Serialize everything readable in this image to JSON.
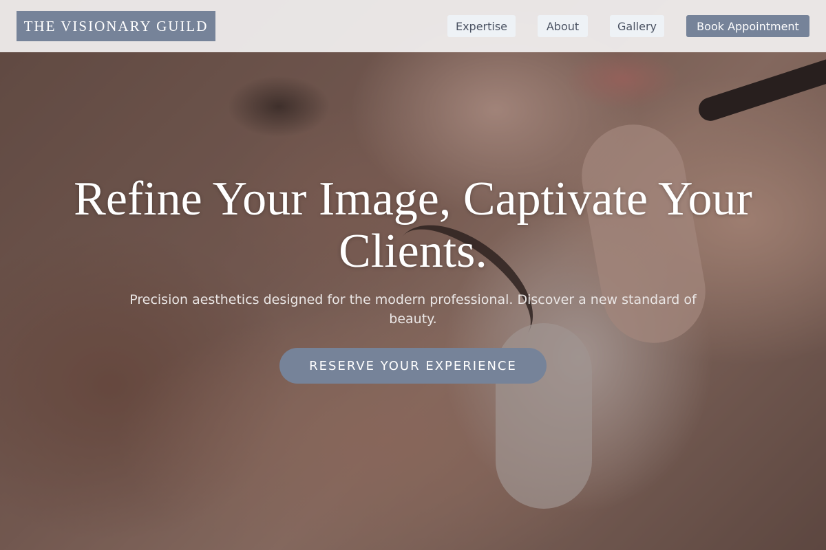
{
  "header": {
    "logo_text": "THE VISIONARY GUILD",
    "nav": {
      "expertise": "Expertise",
      "about": "About",
      "gallery": "Gallery",
      "book": "Book Appointment"
    }
  },
  "hero": {
    "title": "Refine Your Image, Captivate Your Clients.",
    "subtitle": "Precision aesthetics designed for the modern professional. Discover a new standard of beauty.",
    "cta_label": "RESERVE YOUR EXPERIENCE"
  },
  "colors": {
    "accent": "#768399",
    "header_bg": "#f2f0f0",
    "nav_link_bg": "#eef2f6",
    "text_light": "#ffffff"
  }
}
